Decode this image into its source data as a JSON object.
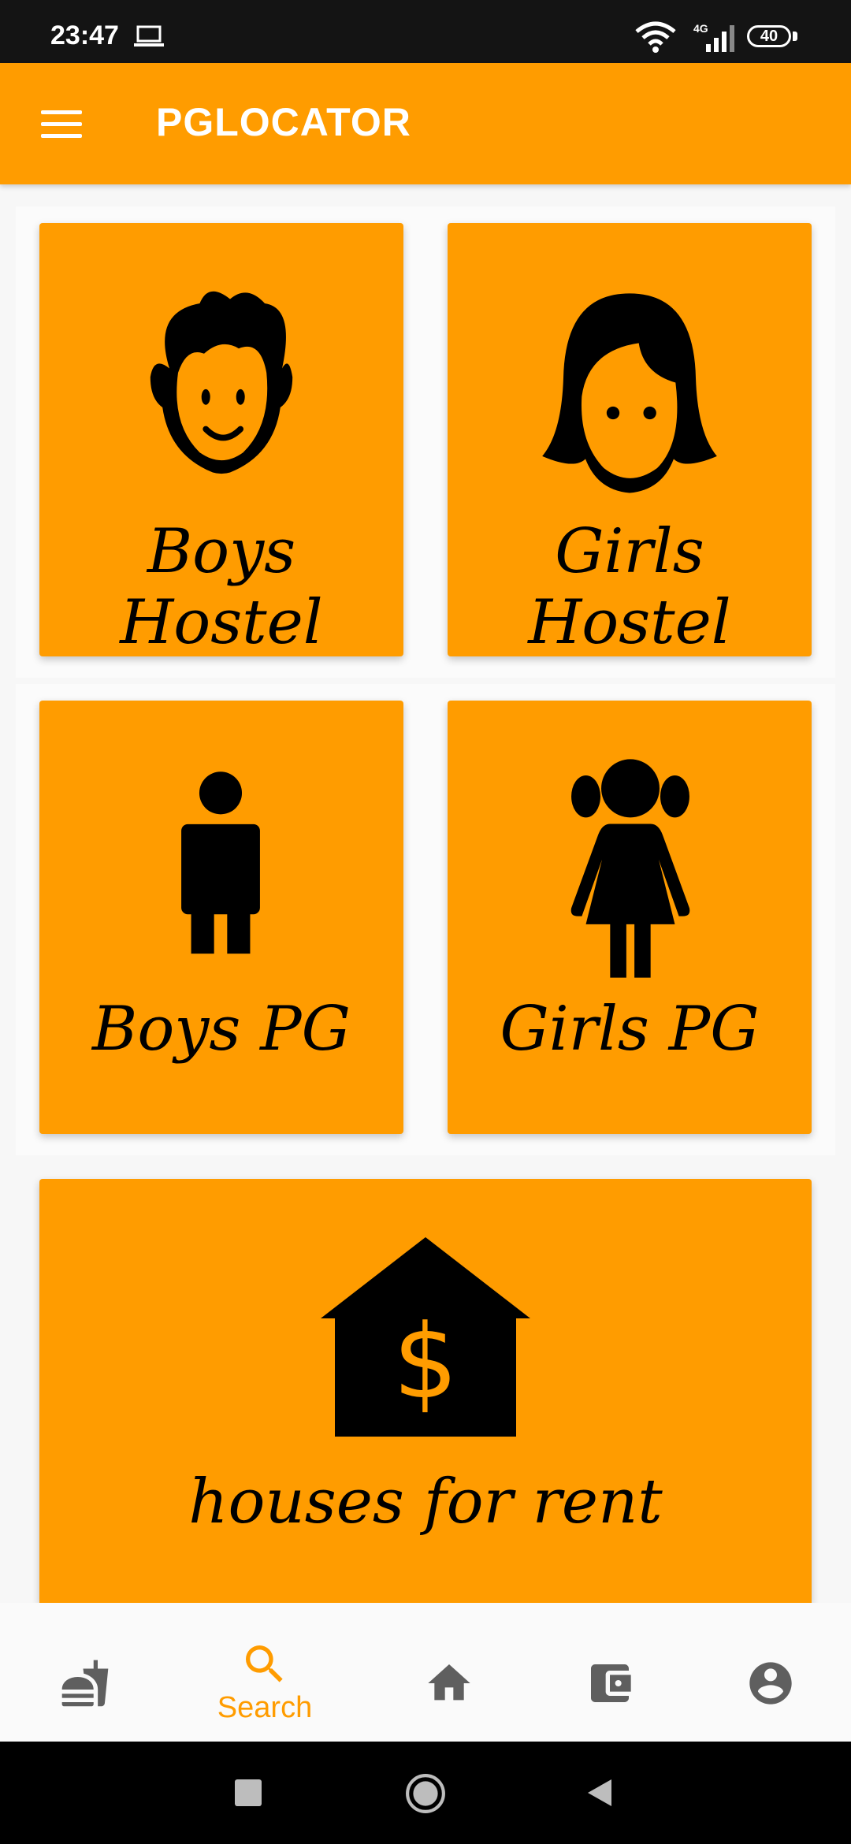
{
  "status_bar": {
    "time": "23:47",
    "network": "4G",
    "battery": "40"
  },
  "app_bar": {
    "title": "PGLOCATOR"
  },
  "cards": [
    {
      "label": "Boys Hostel",
      "icon": "boy-face-icon"
    },
    {
      "label": "Girls Hostel",
      "icon": "girl-face-icon"
    },
    {
      "label": "Boys PG",
      "icon": "man-icon"
    },
    {
      "label": "Girls PG",
      "icon": "girl-icon"
    },
    {
      "label": "houses for rent",
      "icon": "house-dollar-icon"
    }
  ],
  "bottom_nav": {
    "items": [
      {
        "name": "food",
        "icon": "fastfood-icon"
      },
      {
        "name": "search",
        "icon": "search-icon",
        "label": "Search",
        "active": true
      },
      {
        "name": "home",
        "icon": "home-icon"
      },
      {
        "name": "wallet",
        "icon": "wallet-icon"
      },
      {
        "name": "account",
        "icon": "account-circle-icon"
      }
    ]
  },
  "colors": {
    "accent": "#FF9C00",
    "inactive": "#5f5f5f",
    "statusbar": "#141414"
  }
}
